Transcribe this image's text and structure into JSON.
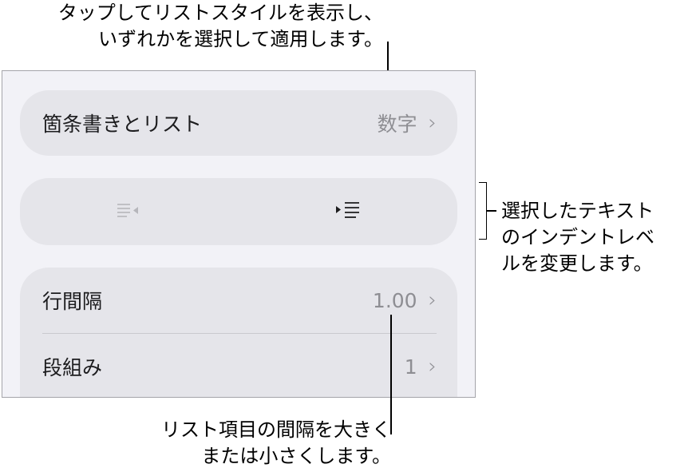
{
  "callouts": {
    "top_line1": "タップしてリストスタイルを表示し、",
    "top_line2": "いずれかを選択して適用します。",
    "right_line1": "選択したテキスト",
    "right_line2": "のインデントレベ",
    "right_line3": "ルを変更します。",
    "bottom_line1": "リスト項目の間隔を大きく",
    "bottom_line2": "または小さくします。"
  },
  "panel": {
    "bullets": {
      "label": "箇条書きとリスト",
      "value": "数字"
    },
    "indent": {
      "decrease_icon": "outdent-icon",
      "increase_icon": "indent-icon"
    },
    "line_spacing": {
      "label": "行間隔",
      "value": "1.00"
    },
    "columns": {
      "label": "段組み",
      "value": "1"
    }
  }
}
